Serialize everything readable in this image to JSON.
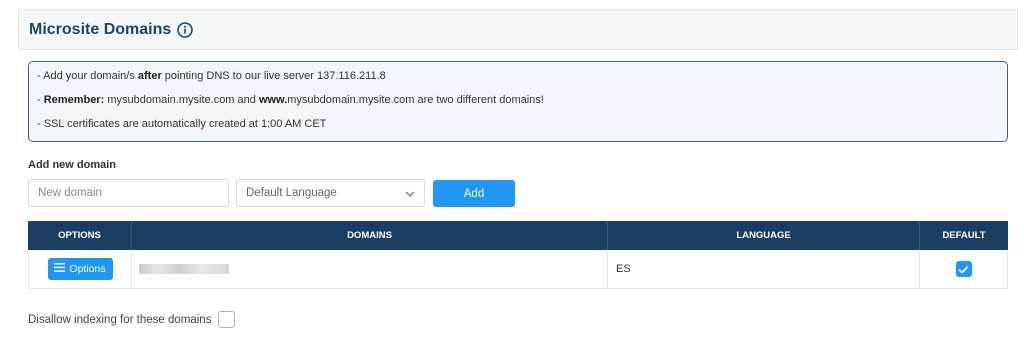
{
  "header": {
    "title": "Microsite Domains",
    "info_icon": "info-circle-icon"
  },
  "notice": {
    "line1": {
      "prefix": "- Add your domain/s ",
      "bold": "after",
      "suffix": " pointing DNS to our live server 137.116.211.8"
    },
    "line2": {
      "prefix": "- ",
      "bold1": "Remember:",
      "mid": " mysubdomain.mysite.com and ",
      "bold2": "www.",
      "suffix": "mysubdomain.mysite.com are two different domains!"
    },
    "line3": "- SSL certificates are automatically created at 1:00 AM CET"
  },
  "add_form": {
    "label": "Add new domain",
    "domain_placeholder": "New domain",
    "language_selected": "Default Language",
    "add_label": "Add"
  },
  "table": {
    "headers": [
      "OPTIONS",
      "DOMAINS",
      "LANGUAGE",
      "DEFAULT"
    ],
    "rows": [
      {
        "options_label": "Options",
        "domain": "",
        "language": "ES",
        "default": true
      }
    ]
  },
  "footer": {
    "disallow_label": "Disallow indexing for these domains",
    "disallow_checked": false
  },
  "colors": {
    "primary": "#2196f3",
    "header_dark": "#1b3f64",
    "title": "#1d4467"
  }
}
